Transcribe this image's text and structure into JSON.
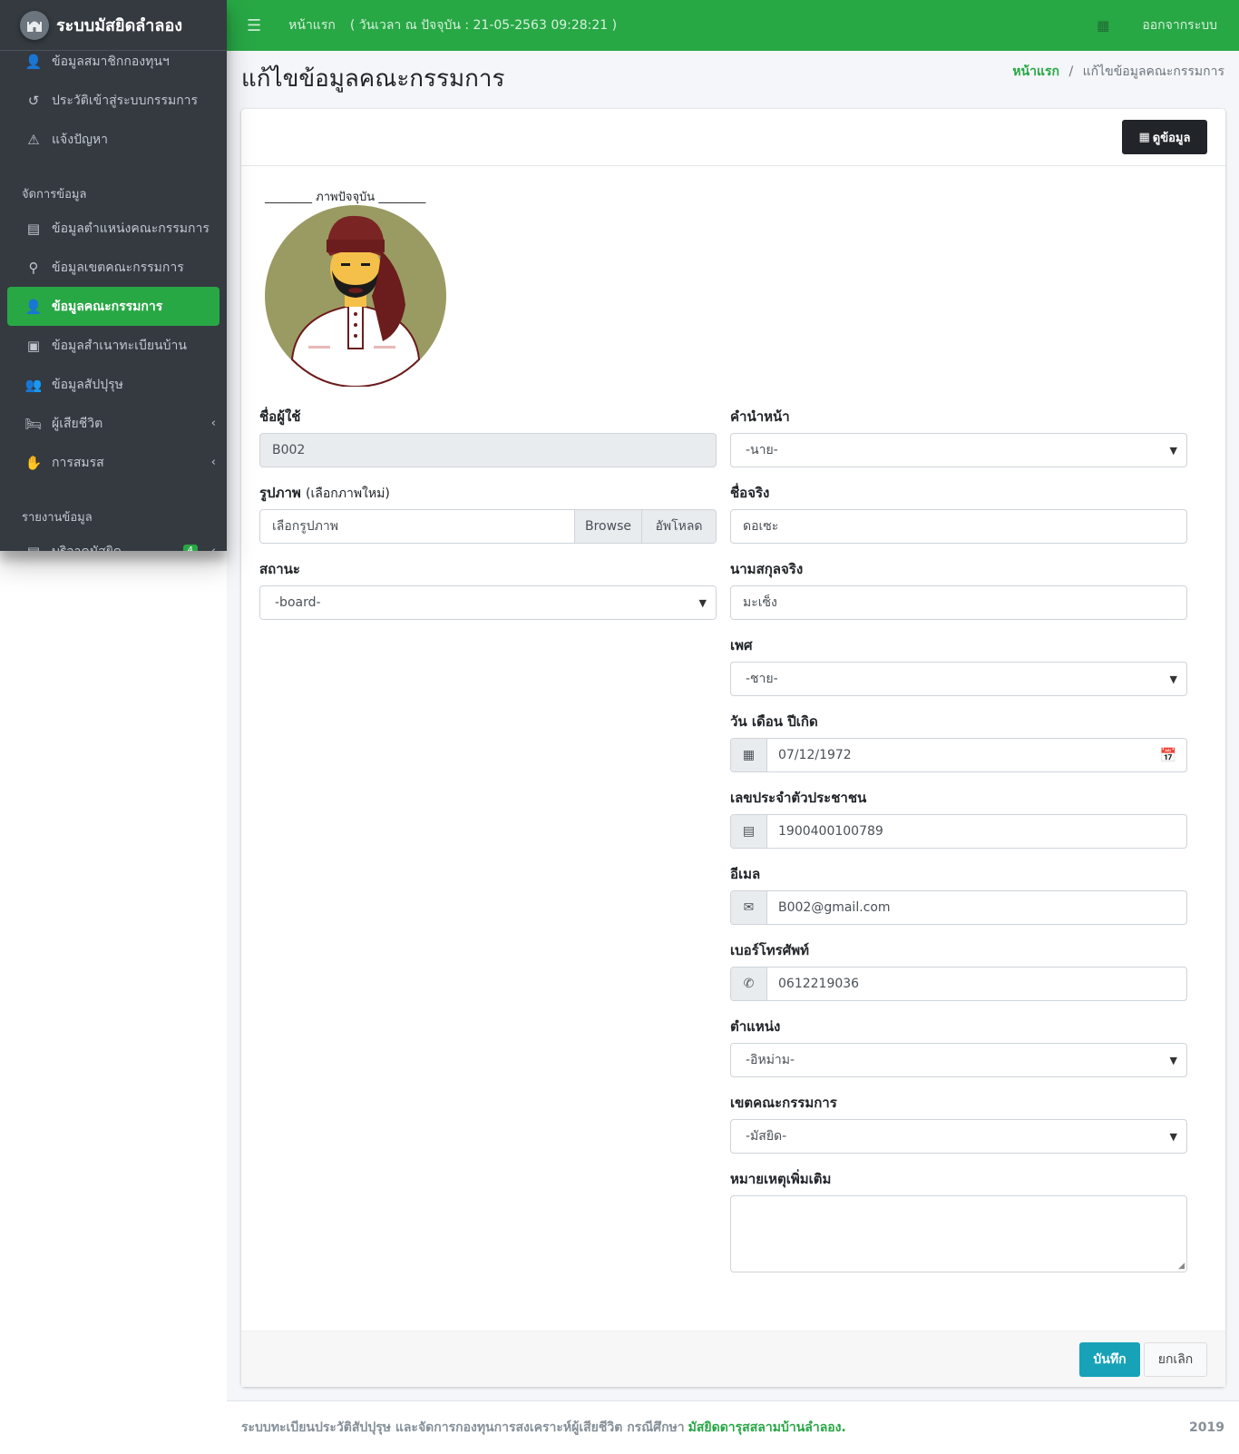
{
  "brand": {
    "title": "ระบบมัสยิดลำลอง",
    "logo_icon": "mosque-icon"
  },
  "sidebar": {
    "items_top": [
      {
        "label": "ข้อมูลสมาชิกกองทุนฯ",
        "icon": "user-icon"
      },
      {
        "label": "ประวัติเข้าสู่ระบบกรรมการ",
        "icon": "history-icon"
      },
      {
        "label": "แจ้งปัญหา",
        "icon": "warning-icon"
      }
    ],
    "header_manage": "จัดการข้อมูล",
    "items_manage": [
      {
        "label": "ข้อมูลตำแหน่งคณะกรรมการ",
        "icon": "id-card-icon"
      },
      {
        "label": "ข้อมูลเขตคณะกรรมการ",
        "icon": "person-pin-icon"
      },
      {
        "label": "ข้อมูลคณะกรรมการ",
        "icon": "user-tie-icon",
        "active": true
      },
      {
        "label": "ข้อมูลสำเนาทะเบียนบ้าน",
        "icon": "address-book-icon"
      },
      {
        "label": "ข้อมูลสัปปุรุษ",
        "icon": "users-icon"
      },
      {
        "label": "ผู้เสียชีวิต",
        "icon": "bed-icon",
        "has_children": true
      },
      {
        "label": "การสมรส",
        "icon": "hand-holding-heart-icon",
        "has_children": true
      }
    ],
    "header_report": "รายงานข้อมูล",
    "items_report": [
      {
        "label": "บริจาคมัสยิด",
        "icon": "report-icon",
        "badge": "4",
        "has_children": true
      }
    ]
  },
  "topbar": {
    "home_label": "หน้าแรก",
    "datetime_text": "( วันเวลา ณ ปัจจุบัน : 21-05-2563 09:28:21 )",
    "logout_label": "ออกจากระบบ"
  },
  "page": {
    "title": "แก้ไขข้อมูลคณะกรรมการ",
    "breadcrumb": {
      "home": "หน้าแรก",
      "sep": "/",
      "current": "แก้ไขข้อมูลคณะกรรมการ"
    }
  },
  "card": {
    "view_button": "ดูข้อมูล",
    "photo_caption": "________ ภาพปัจจุบัน ________",
    "save_button": "บันทึก",
    "cancel_button": "ยกเลิก"
  },
  "form": {
    "username": {
      "label": "ชื่อผู้ใช้",
      "value": "B002"
    },
    "picture": {
      "label": "รูปภาพ",
      "label_hint": "(เลือกภาพใหม่)",
      "placeholder": "เลือกรูปภาพ",
      "browse": "Browse",
      "upload": "อัพโหลด"
    },
    "status": {
      "label": "สถานะ",
      "value": "-board-"
    },
    "prefix": {
      "label": "คำนำหน้า",
      "value": "-นาย-"
    },
    "first_name": {
      "label": "ชื่อจริง",
      "value": "ดอเซะ"
    },
    "last_name": {
      "label": "นามสกุลจริง",
      "value": "มะเซ็ง"
    },
    "gender": {
      "label": "เพศ",
      "value": "-ชาย-"
    },
    "birth_date": {
      "label": "วัน เดือน ปีเกิด",
      "value": "07/12/1972"
    },
    "national_id": {
      "label": "เลขประจำตัวประชาชน",
      "value": "1900400100789"
    },
    "email": {
      "label": "อีเมล",
      "value": "B002@gmail.com"
    },
    "phone": {
      "label": "เบอร์โทรศัพท์",
      "value": "0612219036"
    },
    "position": {
      "label": "ตำแหน่ง",
      "value": "-อิหม่าม-"
    },
    "zone": {
      "label": "เขตคณะกรรมการ",
      "value": "-มัสยิด-"
    },
    "note": {
      "label": "หมายเหตุเพิ่มเติม",
      "value": ""
    }
  },
  "footer": {
    "text": "ระบบทะเบียนประวัติสัปปุรุษ และจัดการกองทุนการสงเคราะห์ผู้เสียชีวิต กรณีศึกษา",
    "link": "มัสยิดดารุสสลามบ้านลำลอง.",
    "year": "2019"
  },
  "colors": {
    "primary_green": "#28a745",
    "sidebar_dark": "#343a40",
    "info_button": "#17a2b8",
    "dark_button": "#212529"
  }
}
